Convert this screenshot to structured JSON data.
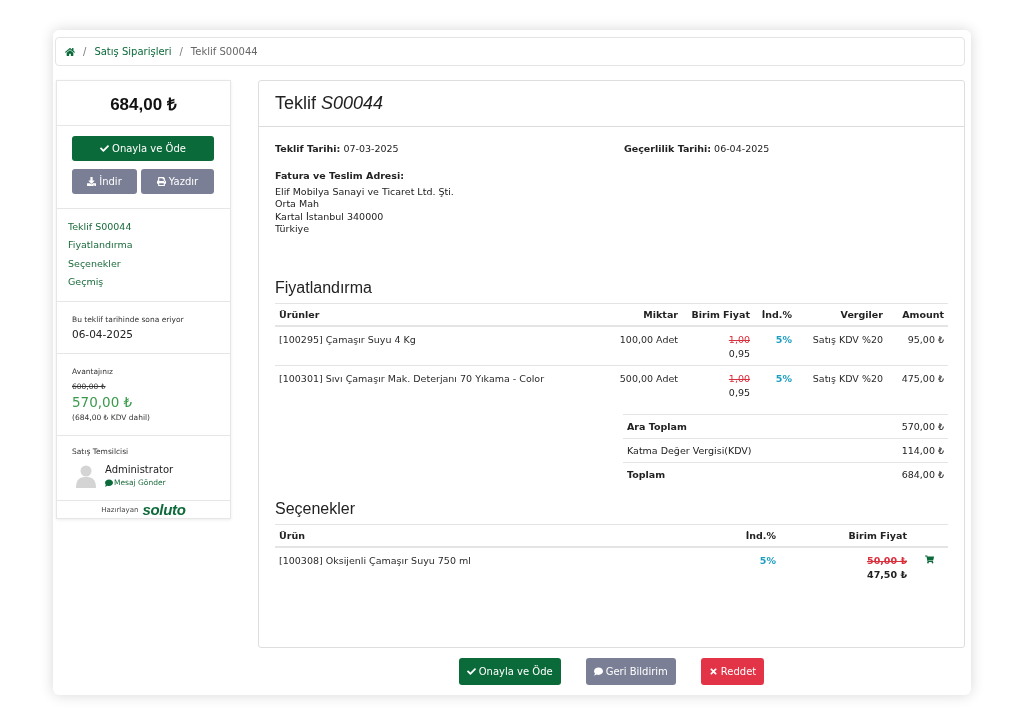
{
  "breadcrumb": {
    "items": [
      {
        "separator": "/",
        "label": "Satış Siparişleri",
        "kind": "link"
      },
      {
        "separator": "/",
        "label": "Teklif S00044",
        "kind": "current"
      }
    ]
  },
  "sidebar": {
    "total": "684,00 ₺",
    "actions": [
      {
        "label": "Onayla ve Öde",
        "kind": "approve"
      },
      {
        "label": "İndir",
        "kind": "download"
      },
      {
        "label": "Yazdır",
        "kind": "print"
      }
    ],
    "nav": [
      "Teklif S00044",
      "Fiyatlandırma",
      "Seçenekler",
      "Geçmiş"
    ],
    "expiry": {
      "label": "Bu teklif tarihinde sona eriyor",
      "date": "06-04-2025"
    },
    "savings": {
      "label": "Avantajınız",
      "old_price": "600,00 ₺",
      "price": "570,00 ₺",
      "note": "(684,00 ₺ KDV dahil)"
    },
    "salesperson": {
      "label": "Satış Temsilcisi",
      "name": "Administrator",
      "message_link": "Mesaj Gönder"
    },
    "footer": {
      "text": "Hazırlayan",
      "logo": "soluto"
    }
  },
  "quote": {
    "title": "Teklif *S00044*",
    "quote_date": "**Teklif Tarihi:** 07-03-2025",
    "validity_date": "**Geçerlilik Tarihi:** 06-04-2025",
    "address_label": "Fatura ve Teslim Adresi:",
    "address_lines": [
      "Elif Mobilya Sanayi ve Ticaret Ltd. Şti.",
      "Orta Mah",
      "Kartal İstanbul 340000",
      "Türkiye"
    ]
  },
  "pricing": {
    "title": "Fiyatlandırma",
    "columns": [
      "Ürünler",
      "Miktar",
      "Birim Fiyat",
      "İnd.%",
      "Vergiler",
      "Amount"
    ],
    "rows": [
      {
        "product": "[100295] Çamaşır Suyu 4 Kg",
        "quantity": "100,00 Adet",
        "old_price": "1,00",
        "price": "0,95",
        "discount": "5%",
        "taxes": "Satış KDV %20",
        "amount": "95,00 ₺"
      },
      {
        "product": "[100301] Sıvı Çamaşır Mak. Deterjanı 70 Yıkama - Color",
        "quantity": "500,00 Adet",
        "old_price": "1,00",
        "price": "0,95",
        "discount": "5%",
        "taxes": "Satış KDV %20",
        "amount": "475,00 ₺"
      }
    ],
    "totals": [
      {
        "label": "Ara Toplam",
        "value": "570,00 ₺",
        "strong": true
      },
      {
        "label": "Katma Değer Vergisi(KDV)",
        "value": "114,00 ₺",
        "strong": false
      },
      {
        "label": "Toplam",
        "value": "684,00 ₺",
        "strong": true
      }
    ]
  },
  "options": {
    "title": "Seçenekler",
    "columns": [
      "Ürün",
      "İnd.%",
      "Birim Fiyat"
    ],
    "rows": [
      {
        "product": "[100308] Oksijenli Çamaşır Suyu 750 ml",
        "discount": "5%",
        "old_price": "50,00 ₺",
        "price": "47,50 ₺"
      }
    ]
  },
  "actions": [
    {
      "label": "Onayla ve Öde",
      "kind": "approve"
    },
    {
      "label": "Geri Bildirim",
      "kind": "feedback"
    },
    {
      "label": "Reddet",
      "kind": "reject"
    }
  ]
}
